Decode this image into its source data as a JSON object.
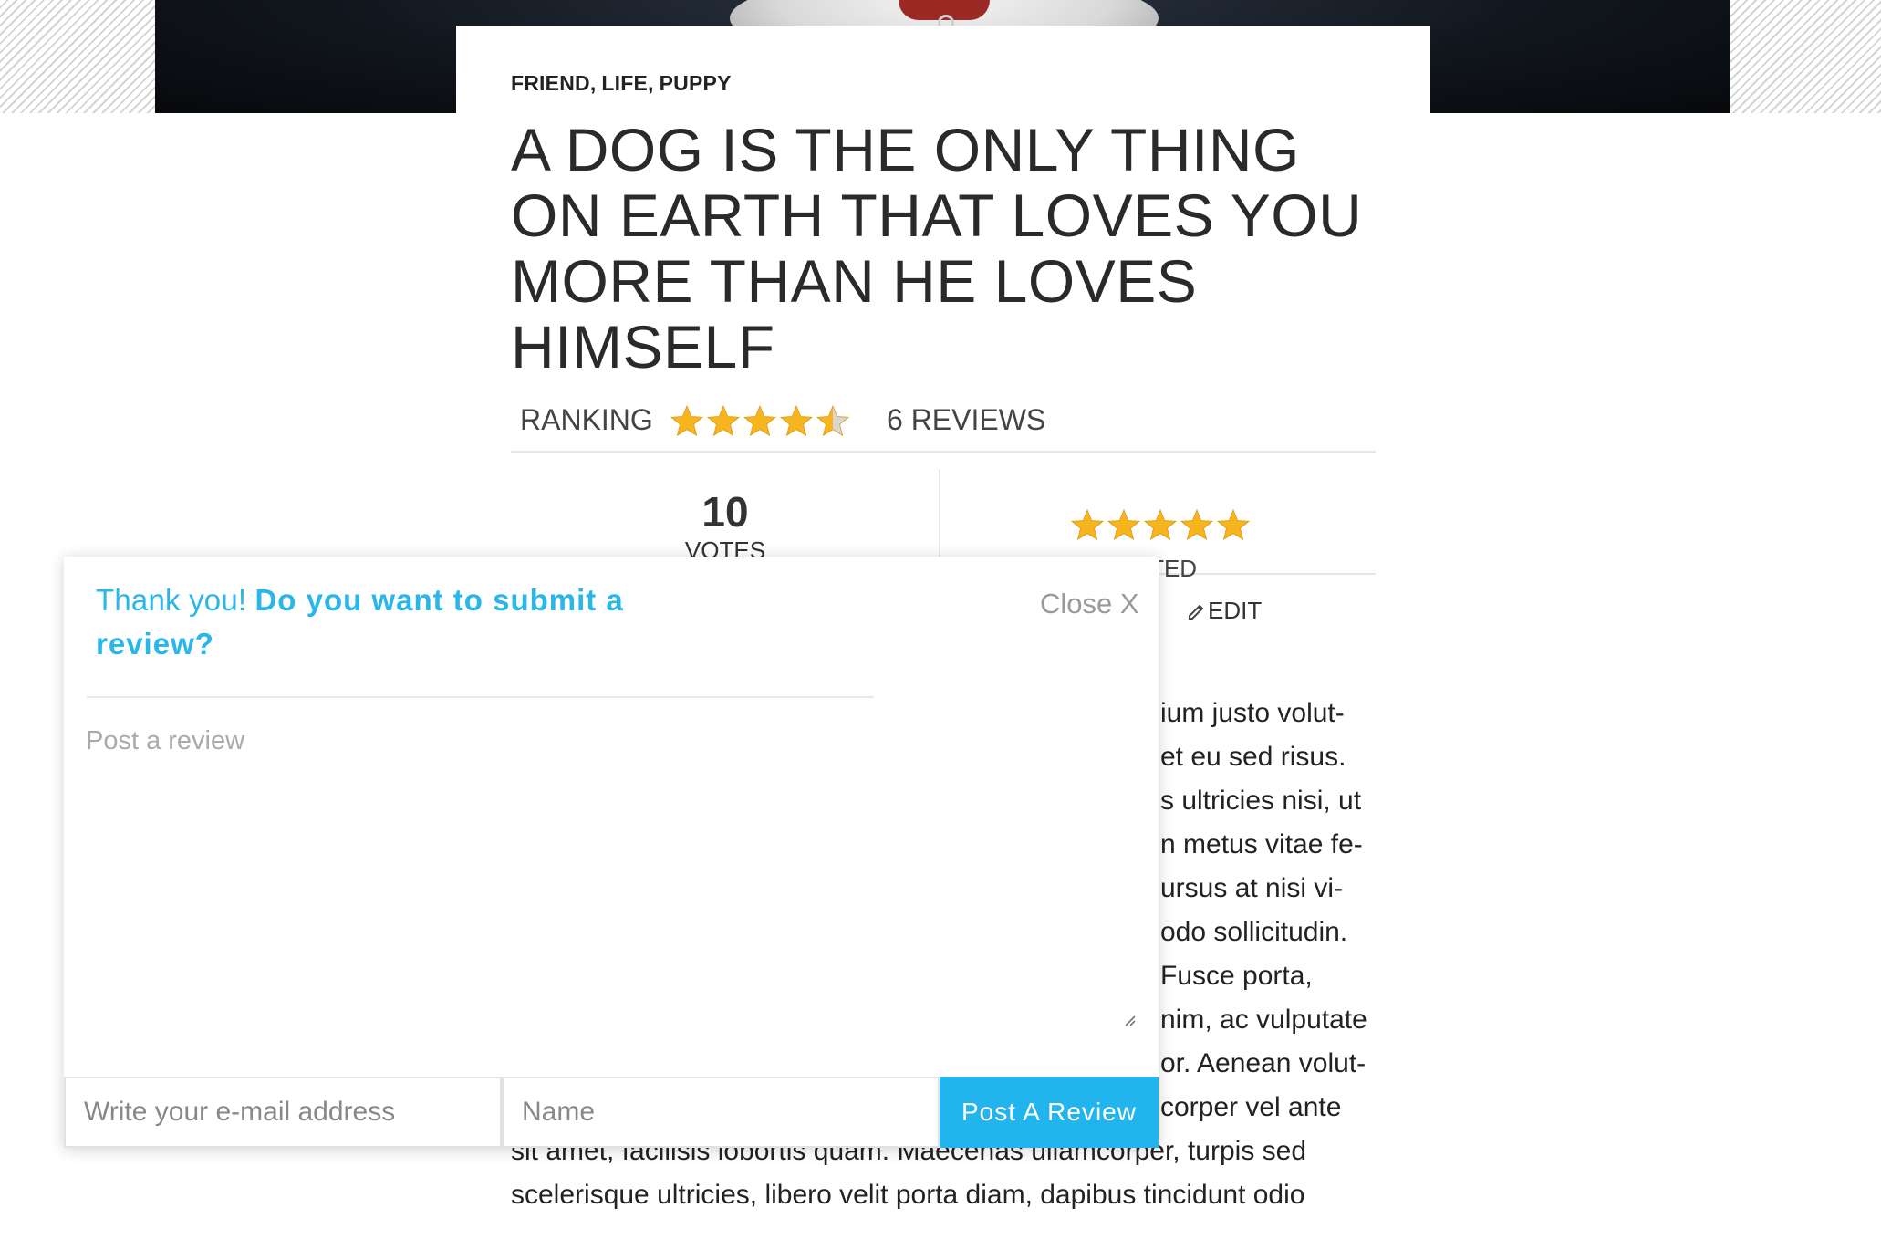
{
  "article": {
    "tags": [
      "FRIEND",
      "LIFE",
      "PUPPY"
    ],
    "tag_separator": ",",
    "title": "A DOG IS THE ONLY THING ON EARTH THAT LOVES YOU MORE THAN HE LOVES HIMSELF",
    "ranking_label": "RANKING",
    "ranking_value": 4.5,
    "ranking_max": 5,
    "reviews_count": "6 REVIEWS",
    "votes_number": "10",
    "votes_label": "VOTES",
    "rated_value": 5,
    "rated_label": "RATED",
    "edit_label": "EDIT",
    "body_lines": [
      "ium justo volut-",
      "et eu sed risus.",
      "s ultricies nisi, ut",
      "n metus vitae fe-",
      "ursus at nisi vi-",
      "odo sollicitudin.",
      "Fusce porta,",
      "nim, ac vulputate",
      "or. Aenean volut-",
      "corper vel ante",
      "sit amet, facilisis lobortis quam. Maecenas ullamcorper, turpis sed",
      "scelerisque ultricies, libero velit porta diam, dapibus tincidunt odio"
    ]
  },
  "review_modal": {
    "thanks_text": "Thank you!",
    "question_text": "Do you want to submit a review?",
    "close_label": "Close X",
    "textarea_placeholder": "Post a review",
    "email_placeholder": "Write your e-mail address",
    "name_placeholder": "Name",
    "submit_label": "Post A Review"
  },
  "colors": {
    "accent": "#22b4ec",
    "heading_blue": "#29b6e8",
    "star_gold": "#f6b51e",
    "star_empty": "#d6d6d6"
  }
}
